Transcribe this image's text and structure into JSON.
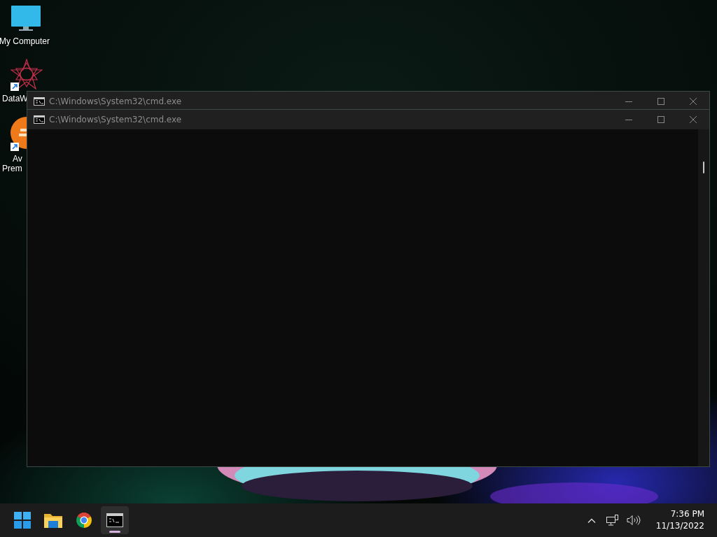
{
  "desktop_icons": [
    {
      "kind": "monitor",
      "lines": [
        "My Computer"
      ],
      "shortcut": false
    },
    {
      "kind": "star",
      "lines": [
        "DataW"
      ],
      "shortcut": true
    },
    {
      "kind": "orange",
      "lines": [
        "Av",
        "Prem"
      ],
      "shortcut": true
    }
  ],
  "windows": [
    {
      "title": "C:\\Windows\\System32\\cmd.exe",
      "front": false
    },
    {
      "title": "C:\\Windows\\System32\\cmd.exe",
      "front": true
    }
  ],
  "taskbar": {
    "apps": [
      {
        "kind": "start",
        "active": false
      },
      {
        "kind": "folder",
        "active": false
      },
      {
        "kind": "chrome",
        "active": false
      },
      {
        "kind": "terminal",
        "active": true
      }
    ],
    "time": "7:36 PM",
    "date": "11/13/2022"
  }
}
